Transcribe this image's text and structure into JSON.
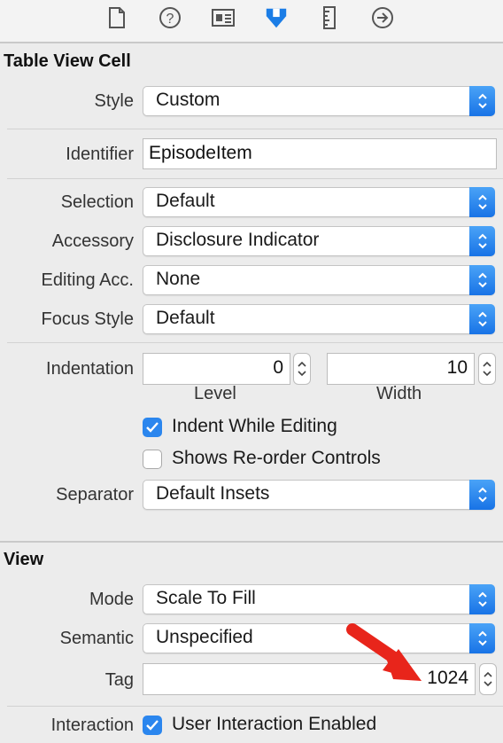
{
  "toolbar": {
    "icons": [
      "file-inspector-icon",
      "quick-help-icon",
      "identity-inspector-icon",
      "attributes-inspector-icon",
      "size-inspector-icon",
      "connections-inspector-icon"
    ]
  },
  "table_view_cell": {
    "title": "Table View Cell",
    "style": {
      "label": "Style",
      "value": "Custom"
    },
    "identifier": {
      "label": "Identifier",
      "value": "EpisodeItem"
    },
    "selection": {
      "label": "Selection",
      "value": "Default"
    },
    "accessory": {
      "label": "Accessory",
      "value": "Disclosure Indicator"
    },
    "editing_acc": {
      "label": "Editing Acc.",
      "value": "None"
    },
    "focus_style": {
      "label": "Focus Style",
      "value": "Default"
    },
    "indentation": {
      "label": "Indentation",
      "level_value": "0",
      "level_label": "Level",
      "width_value": "10",
      "width_label": "Width"
    },
    "indent_while_editing": {
      "label": "Indent While Editing",
      "checked": true
    },
    "shows_reorder": {
      "label": "Shows Re-order Controls",
      "checked": false
    },
    "separator": {
      "label": "Separator",
      "value": "Default Insets"
    }
  },
  "view": {
    "title": "View",
    "mode": {
      "label": "Mode",
      "value": "Scale To Fill"
    },
    "semantic": {
      "label": "Semantic",
      "value": "Unspecified"
    },
    "tag": {
      "label": "Tag",
      "value": "1024"
    },
    "interaction": {
      "label": "Interaction",
      "checkbox_label": "User Interaction Enabled",
      "checked": true
    }
  },
  "colors": {
    "accent": "#1873e6",
    "annotation_arrow": "#e8251b"
  }
}
